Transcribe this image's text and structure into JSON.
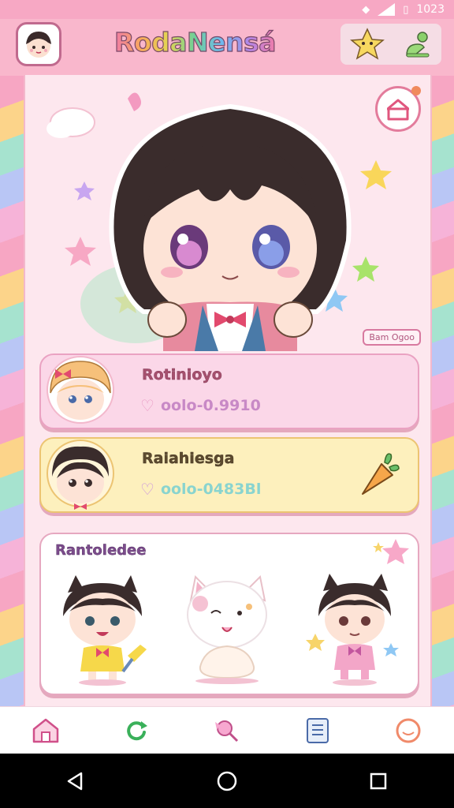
{
  "status_bar": {
    "time": "1023"
  },
  "header": {
    "title": "RodaNensá"
  },
  "hero": {
    "tag": "Bam Ogoo"
  },
  "cards": [
    {
      "name": "Rotinioyo",
      "stat": "oolo-0.9910"
    },
    {
      "name": "Raiahiesga",
      "stat": "oolo-0483Bl"
    }
  ],
  "gallery": {
    "title": "Rantoledee"
  },
  "colors": {
    "accent": "#f7a8c4",
    "pink_card": "#fbd7e8",
    "yellow_card": "#fdf0bd"
  },
  "tabs": [
    {
      "icon": "house-icon"
    },
    {
      "icon": "refresh-icon"
    },
    {
      "icon": "candy-icon"
    },
    {
      "icon": "list-icon"
    },
    {
      "icon": "smile-icon"
    }
  ],
  "nav": [
    {
      "icon": "back-icon"
    },
    {
      "icon": "home-circle-icon"
    },
    {
      "icon": "recents-icon"
    }
  ]
}
